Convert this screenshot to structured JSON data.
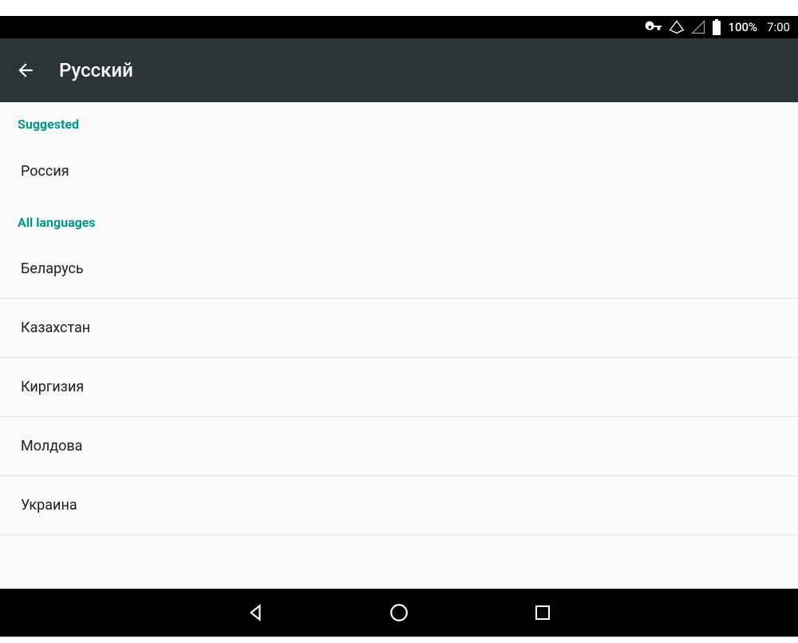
{
  "status": {
    "battery_pct": "100%",
    "clock": "7:00"
  },
  "appbar": {
    "title": "Русский"
  },
  "sections": {
    "suggested_label": "Suggested",
    "all_label": "All languages"
  },
  "suggested": [
    {
      "label": "Россия"
    }
  ],
  "all": [
    {
      "label": "Беларусь"
    },
    {
      "label": "Казахстан"
    },
    {
      "label": "Киргизия"
    },
    {
      "label": "Молдова"
    },
    {
      "label": "Украина"
    }
  ]
}
